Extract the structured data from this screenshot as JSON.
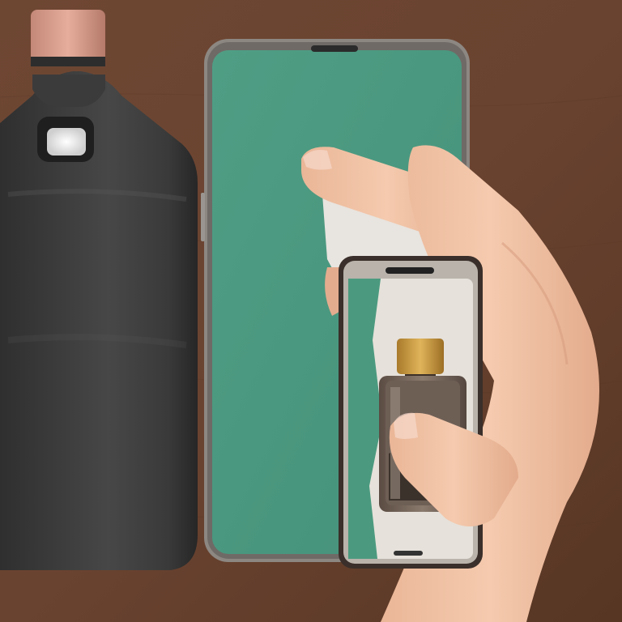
{
  "scene": {
    "description_visible_text": "",
    "palette": {
      "wood_background": "#6b4531",
      "wood_dark": "#4d2f20",
      "bottle_body": "#3e3e3e",
      "bottle_highlight": "#6a6a6a",
      "bottle_cap": "#d9a090",
      "phone_frame": "#8f8a86",
      "phone_screen": "#4c9a80",
      "phone_screen_light": "#5aab90",
      "torn_paper": "#e8e4df",
      "small_phone_frame": "#3a2f2a",
      "mini_bottle_cap": "#c89a3c",
      "mini_bottle_glass": "#7a6a5e",
      "skin": "#f1c3a5",
      "skin_shadow": "#d99f82",
      "nail": "#f6d8cc"
    }
  }
}
